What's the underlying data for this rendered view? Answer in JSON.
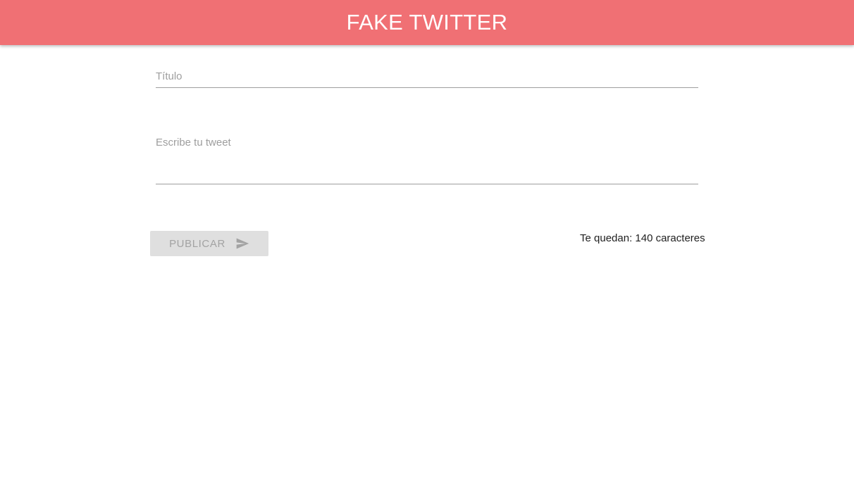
{
  "header": {
    "title": "FAKE TWITTER"
  },
  "form": {
    "title_field": {
      "placeholder": "Título",
      "value": ""
    },
    "tweet_field": {
      "placeholder": "Escribe tu tweet",
      "value": ""
    },
    "publish_label": "PUBLICAR",
    "publish_icon": "send-icon",
    "counter_text": "Te quedan: 140 caracteres"
  },
  "colors": {
    "appbar": "#f07074",
    "button_disabled_bg": "#dfdfdf",
    "button_disabled_text": "#a3a3a3",
    "input_underline": "#9e9e9e"
  }
}
